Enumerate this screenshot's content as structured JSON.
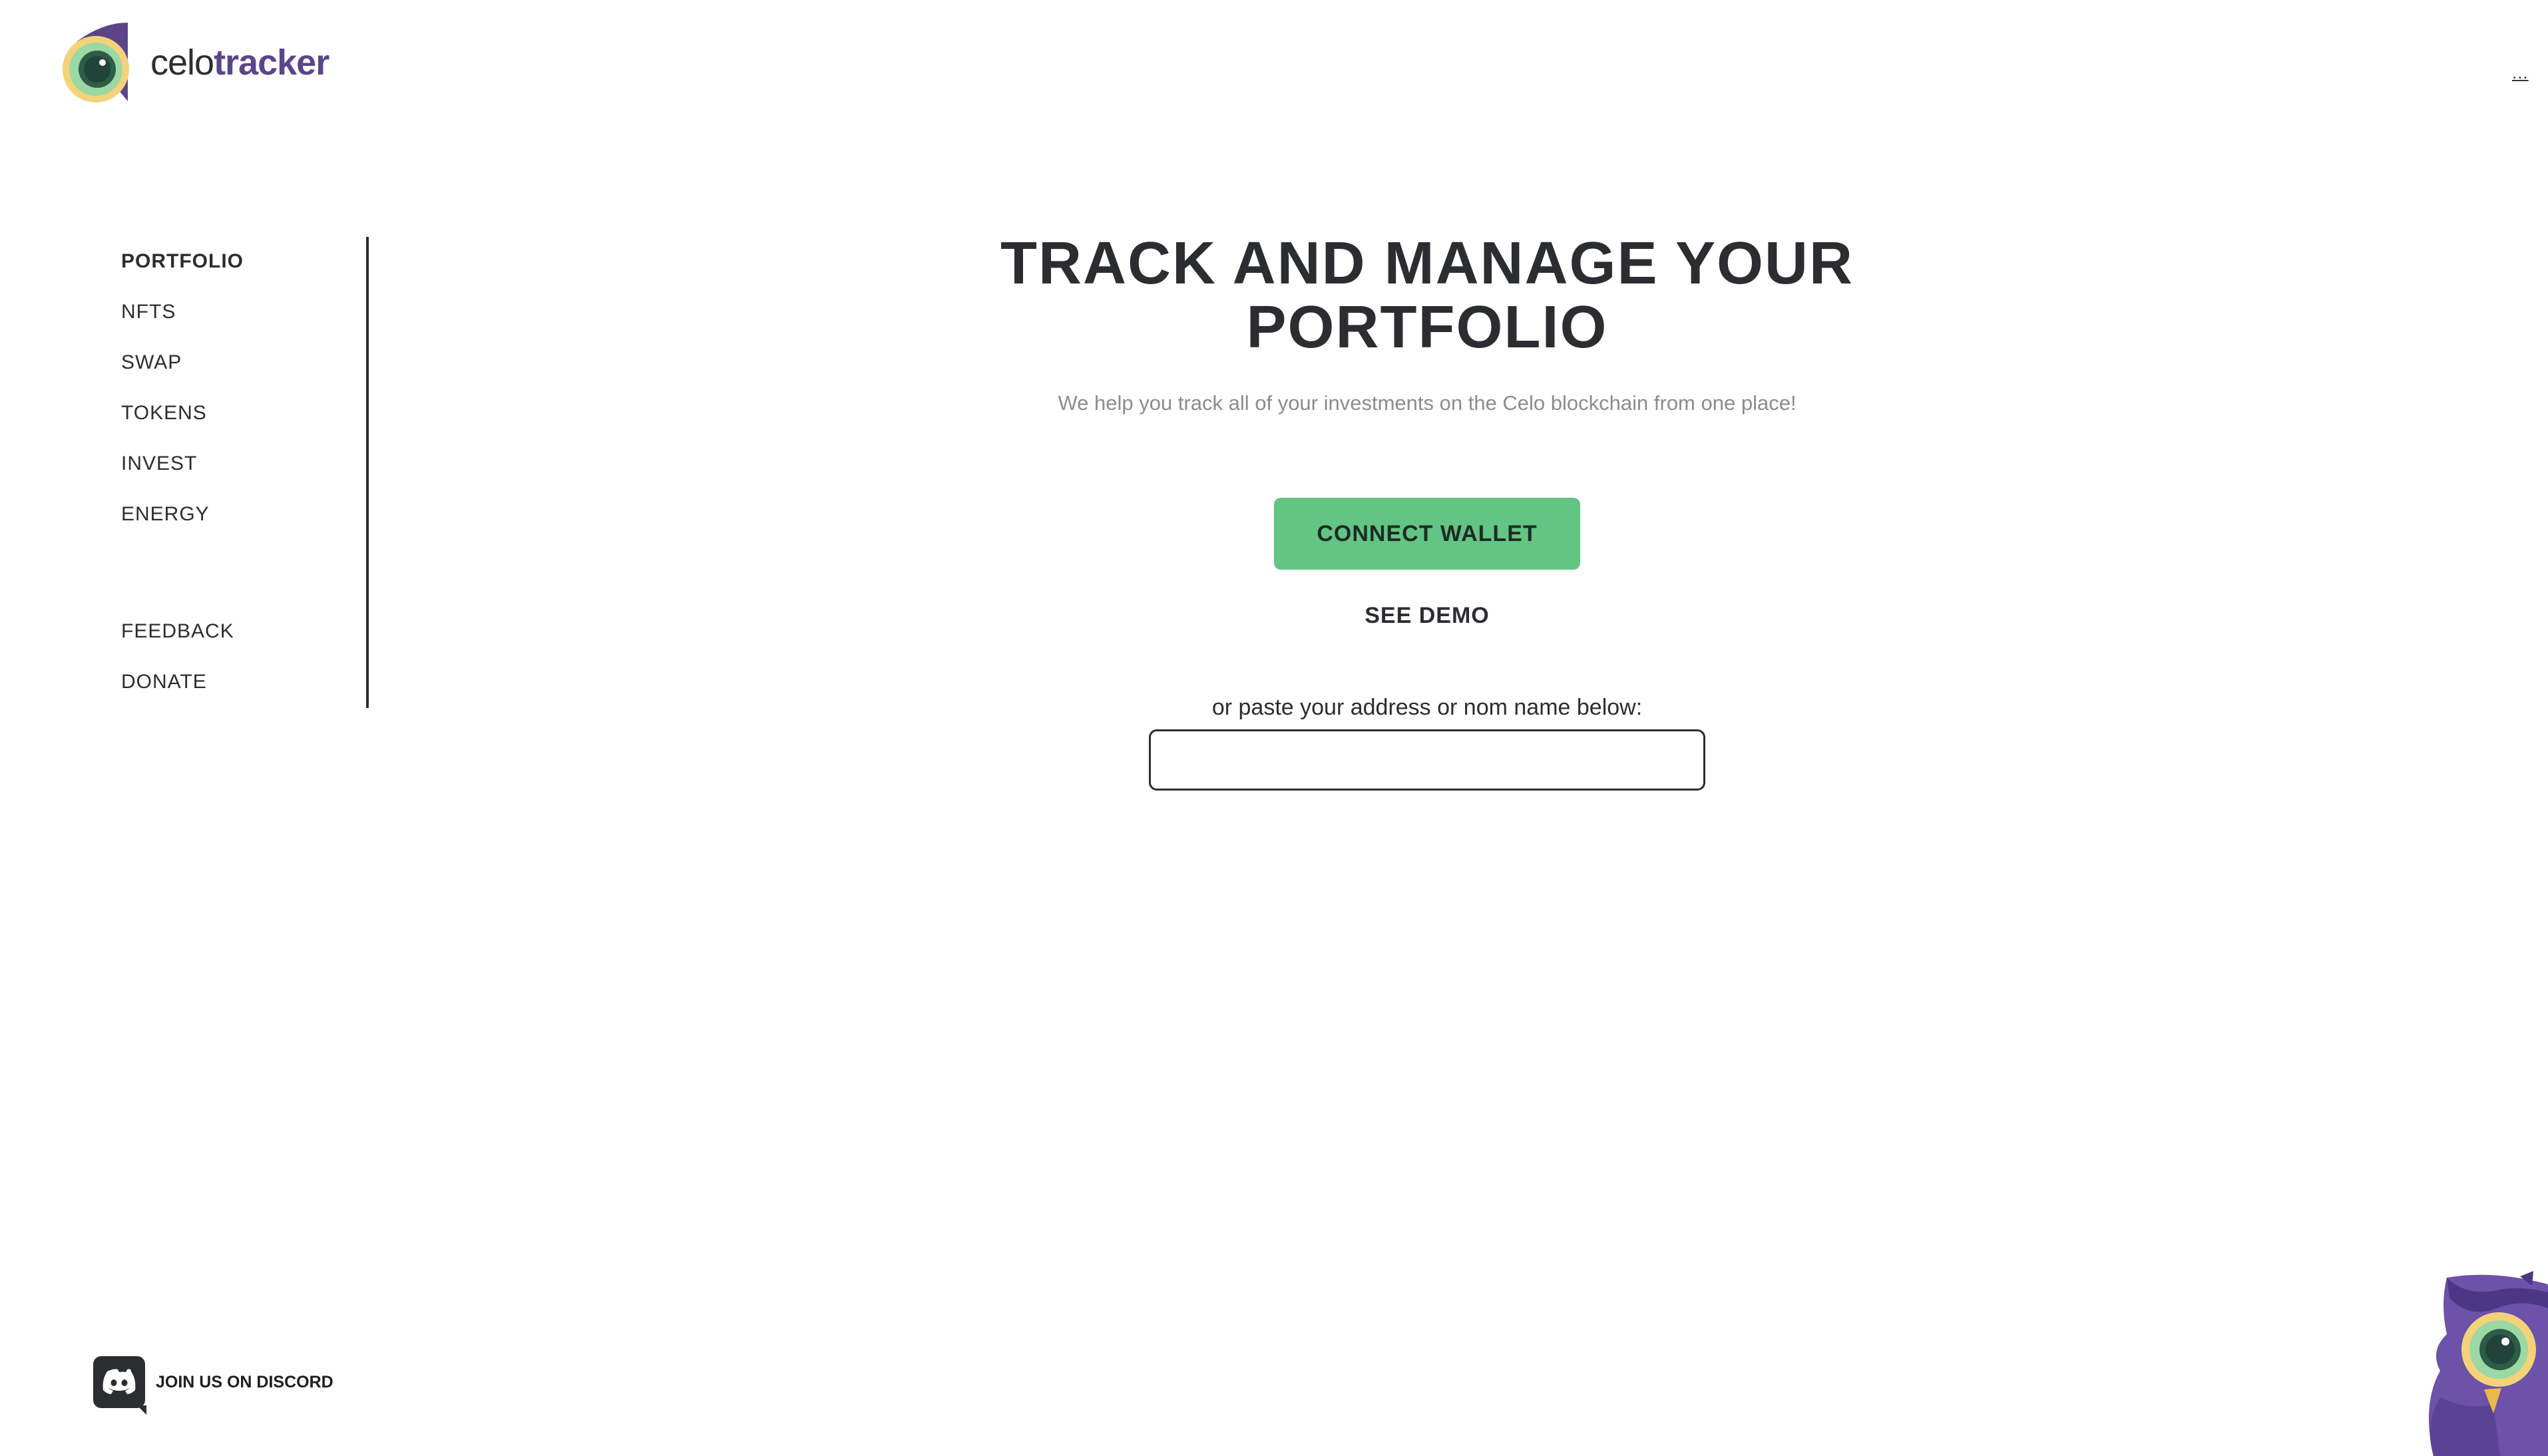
{
  "header": {
    "brand_light": "celo",
    "brand_bold": "tracker",
    "menu_label": "..."
  },
  "sidebar": {
    "items": [
      {
        "label": "PORTFOLIO",
        "active": true
      },
      {
        "label": "NFTS",
        "active": false
      },
      {
        "label": "SWAP",
        "active": false
      },
      {
        "label": "TOKENS",
        "active": false
      },
      {
        "label": "INVEST",
        "active": false
      },
      {
        "label": "ENERGY",
        "active": false
      }
    ],
    "secondary_items": [
      {
        "label": "FEEDBACK"
      },
      {
        "label": "DONATE"
      }
    ]
  },
  "main": {
    "title_line1": "TRACK AND MANAGE YOUR",
    "title_line2": "PORTFOLIO",
    "subtitle": "We help you track all of your investments on the Celo blockchain from one place!",
    "connect_button": "CONNECT WALLET",
    "demo_link": "SEE DEMO",
    "paste_label": "or paste your address or nom name below:",
    "address_value": "",
    "address_placeholder": ""
  },
  "footer": {
    "discord_label": "JOIN US ON DISCORD"
  },
  "colors": {
    "accent_green": "#62c583",
    "brand_purple": "#5b4588",
    "text_dark": "#2b2d31",
    "text_muted": "#8c8c8c"
  },
  "icons": {
    "logo": "celotracker-eye-logo",
    "discord": "discord-icon",
    "mascot": "owl-mascot"
  }
}
